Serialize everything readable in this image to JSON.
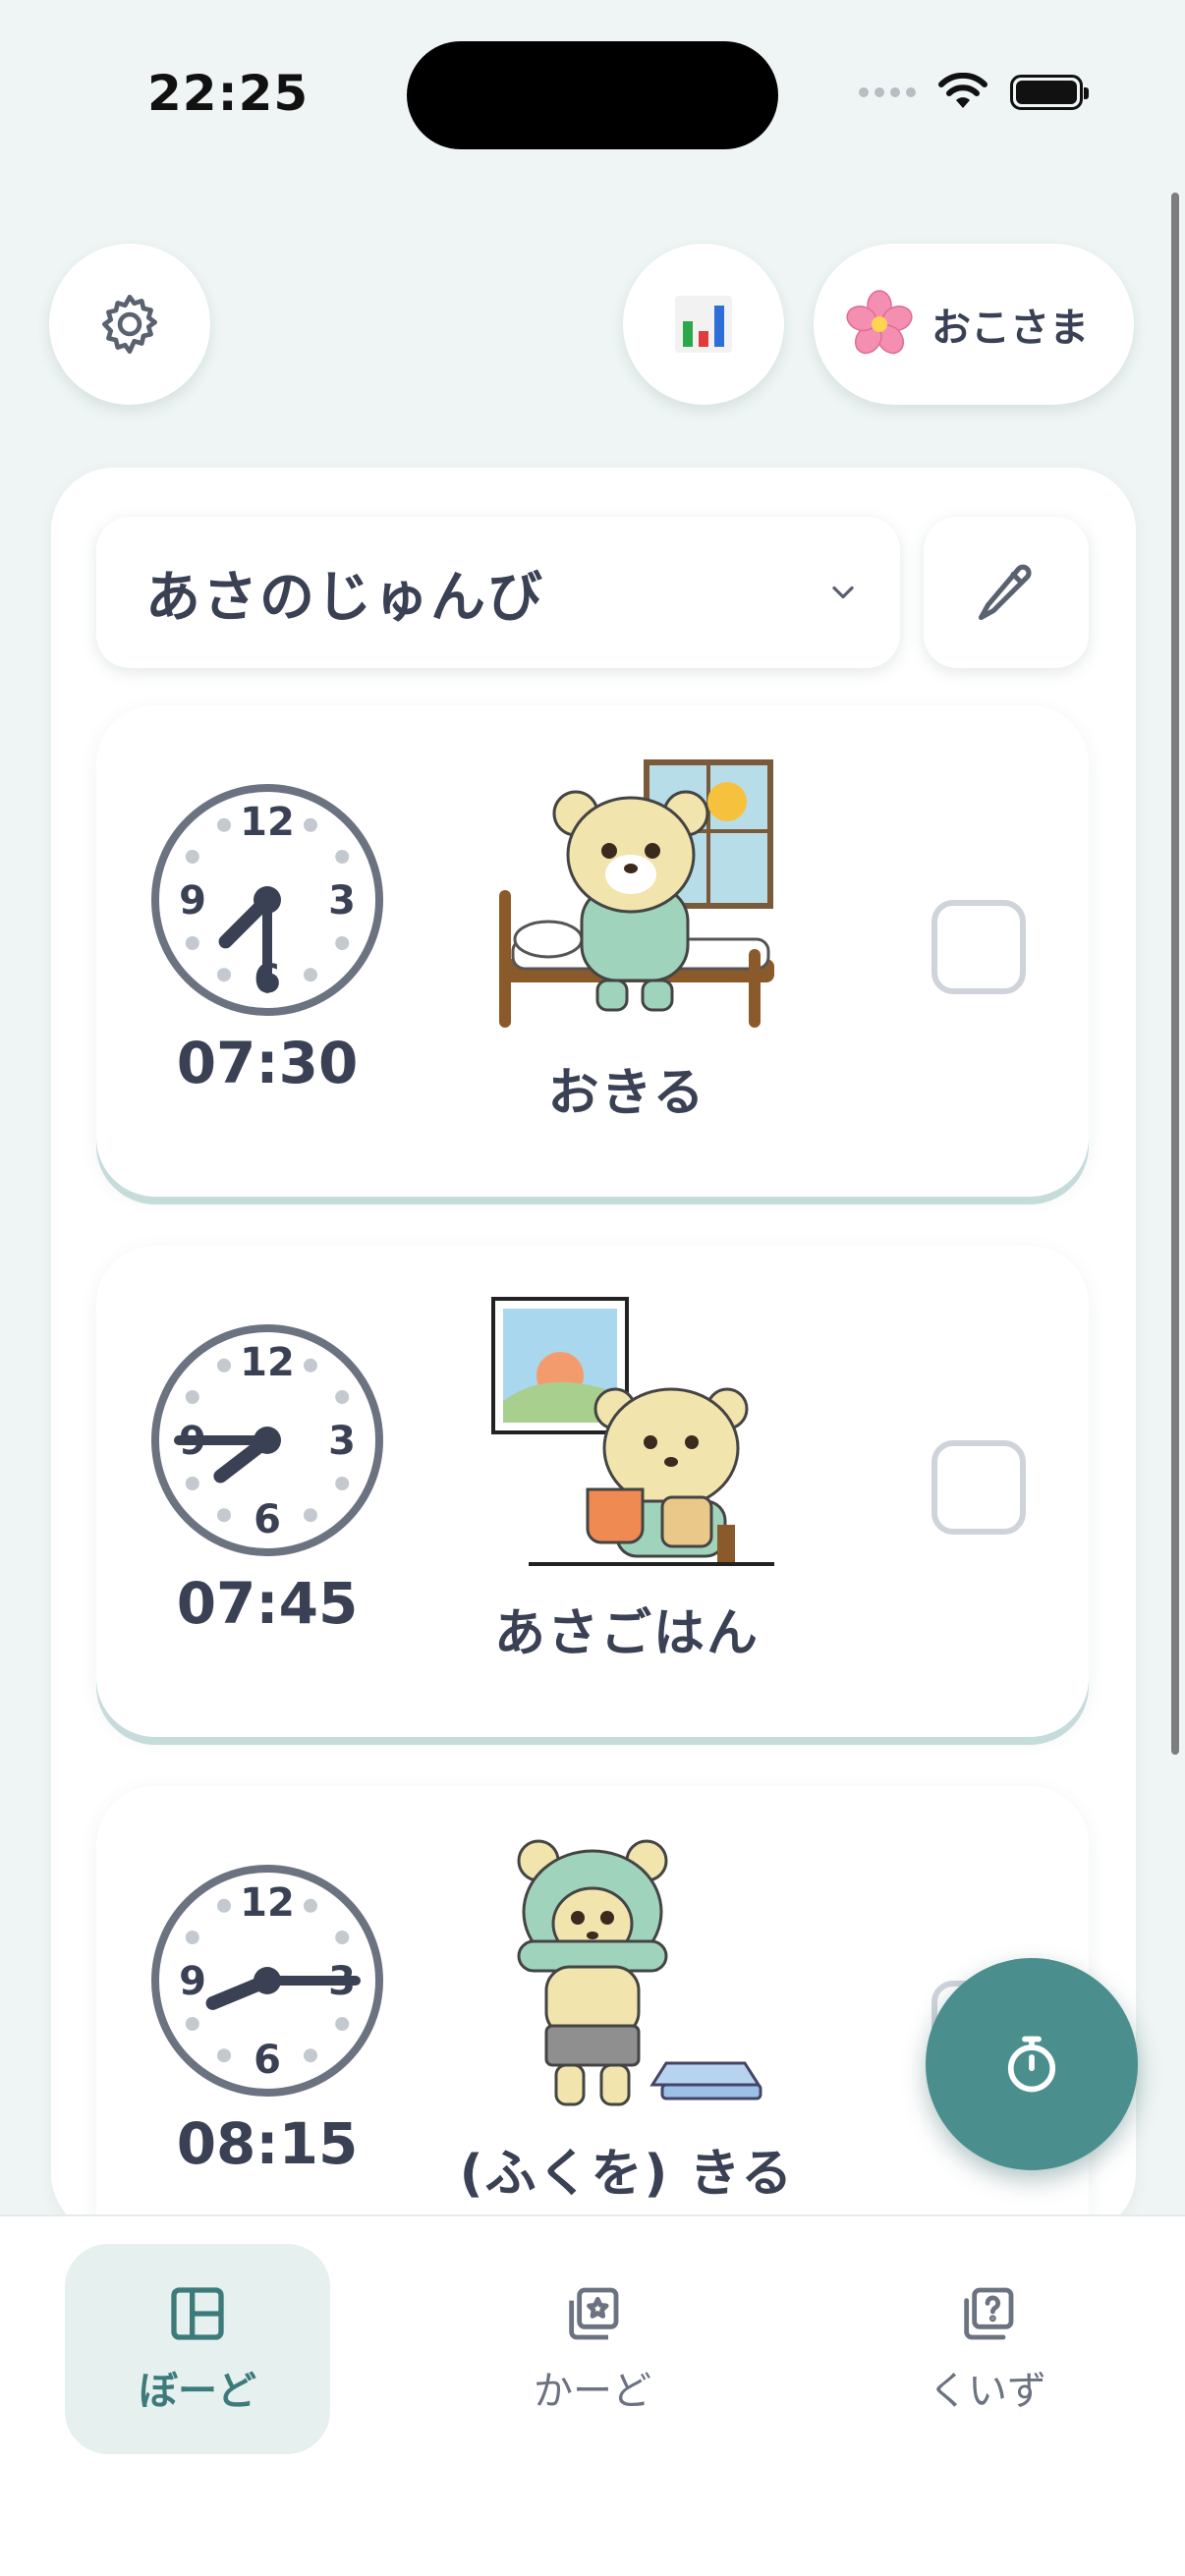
{
  "status_bar": {
    "time": "22:25"
  },
  "header": {
    "settings_icon": "gear-icon",
    "stats_icon": "bar-chart-icon",
    "profile": {
      "emoji": "🌸",
      "name": "おこさま"
    }
  },
  "routine": {
    "title": "あさのじゅんび",
    "edit_icon": "pencil-icon"
  },
  "tasks": [
    {
      "time": "07:30",
      "label": "おきる",
      "hour": 7,
      "minute": 30,
      "done": false
    },
    {
      "time": "07:45",
      "label": "あさごはん",
      "hour": 7,
      "minute": 45,
      "done": false
    },
    {
      "time": "08:15",
      "label": "(ふくを) きる",
      "hour": 8,
      "minute": 15,
      "done": false
    }
  ],
  "clock_numbers": {
    "n12": "12",
    "n3": "3",
    "n6": "6",
    "n9": "9"
  },
  "fab": {
    "icon": "timer-icon"
  },
  "tab_bar": {
    "tabs": [
      {
        "label": "ぼーど",
        "icon": "board-icon",
        "active": true
      },
      {
        "label": "かーど",
        "icon": "cards-icon",
        "active": false
      },
      {
        "label": "くいず",
        "icon": "quiz-icon",
        "active": false
      }
    ]
  },
  "colors": {
    "accent": "#4a8f8e",
    "background": "#eef5f4",
    "text": "#3a4154"
  }
}
